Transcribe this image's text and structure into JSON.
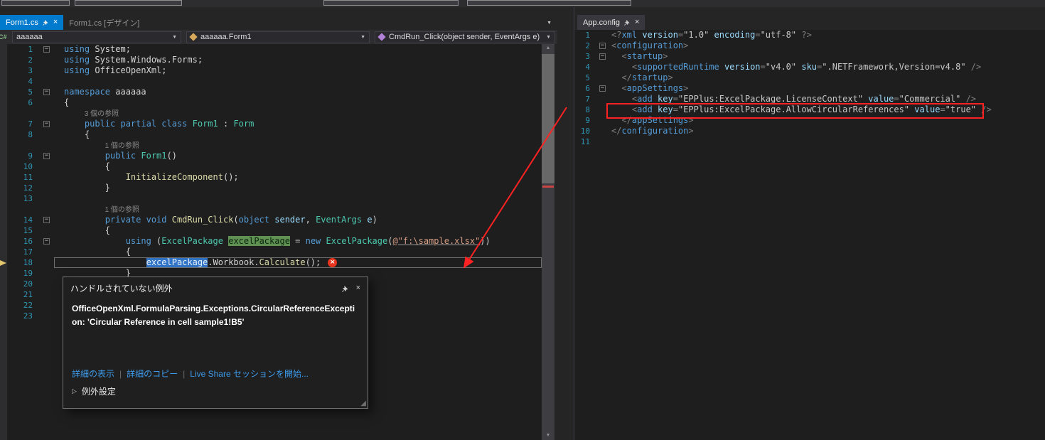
{
  "colors": {
    "accent_blue": "#007ACC",
    "annotation_red": "#FF2222",
    "error_red": "#E8341C",
    "link_blue": "#3E9BE9",
    "keyword": "#569CD6",
    "type": "#4EC9B0",
    "method": "#DCDCAA",
    "string": "#D69D85",
    "line_number": "#2F96B4",
    "reference_highlight_green": "#5E9152",
    "selection_highlight_blue": "#3173C4"
  },
  "icons": {
    "close": "×",
    "chevron_down": "▼",
    "caret_down": "▼",
    "fold_collapse": "−",
    "scroll_up": "▲",
    "scroll_down": "▼",
    "expander": "▷",
    "error": "×",
    "resize_grip": "◢",
    "csharp_project": "C#",
    "link_separator": "|"
  },
  "left_group": {
    "tabs": [
      {
        "label": "Form1.cs",
        "active": true
      },
      {
        "label": "Form1.cs [デザイン]",
        "active": false
      }
    ]
  },
  "navbar": {
    "project": "aaaaaa",
    "type": "aaaaaa.Form1",
    "member": "CmdRun_Click(object sender, EventArgs e)"
  },
  "right_group": {
    "tabs": [
      {
        "label": "App.config",
        "active": true
      }
    ]
  },
  "left_editor": {
    "rows": [
      {
        "n": 1,
        "fold": true,
        "tokens": [
          [
            "using ",
            "kw"
          ],
          [
            "System;",
            "pl"
          ]
        ]
      },
      {
        "n": 2,
        "tokens": [
          [
            "using ",
            "kw"
          ],
          [
            "System.Windows.Forms;",
            "pl"
          ]
        ]
      },
      {
        "n": 3,
        "tokens": [
          [
            "using ",
            "kw"
          ],
          [
            "OfficeOpenXml;",
            "pl"
          ]
        ]
      },
      {
        "n": 4,
        "tokens": []
      },
      {
        "n": 5,
        "fold": true,
        "tokens": [
          [
            "namespace ",
            "kw"
          ],
          [
            "aaaaaa",
            "pl"
          ]
        ]
      },
      {
        "n": 6,
        "tokens": [
          [
            "{",
            "pl"
          ]
        ]
      },
      {
        "codelens": true,
        "indent": 4,
        "text": "3 個の参照"
      },
      {
        "n": 7,
        "fold": true,
        "tokens": [
          [
            "    ",
            "pl"
          ],
          [
            "public partial class ",
            "kw"
          ],
          [
            "Form1",
            "ty"
          ],
          [
            " : ",
            "pl"
          ],
          [
            "Form",
            "ty"
          ]
        ]
      },
      {
        "n": 8,
        "tokens": [
          [
            "    {",
            "pl"
          ]
        ]
      },
      {
        "codelens": true,
        "indent": 8,
        "text": "1 個の参照"
      },
      {
        "n": 9,
        "fold": true,
        "tokens": [
          [
            "        ",
            "pl"
          ],
          [
            "public ",
            "kw"
          ],
          [
            "Form1",
            "ty"
          ],
          [
            "()",
            "pl"
          ]
        ]
      },
      {
        "n": 10,
        "tokens": [
          [
            "        {",
            "pl"
          ]
        ]
      },
      {
        "n": 11,
        "tokens": [
          [
            "            ",
            "pl"
          ],
          [
            "InitializeComponent",
            "me"
          ],
          [
            "();",
            "pl"
          ]
        ]
      },
      {
        "n": 12,
        "tokens": [
          [
            "        }",
            "pl"
          ]
        ]
      },
      {
        "n": 13,
        "tokens": []
      },
      {
        "codelens": true,
        "indent": 8,
        "text": "1 個の参照"
      },
      {
        "n": 14,
        "fold": true,
        "tokens": [
          [
            "        ",
            "pl"
          ],
          [
            "private void ",
            "kw"
          ],
          [
            "CmdRun_Click",
            "me"
          ],
          [
            "(",
            "pl"
          ],
          [
            "object",
            "kw"
          ],
          [
            " ",
            "pl"
          ],
          [
            "sender",
            "pa"
          ],
          [
            ", ",
            "pl"
          ],
          [
            "EventArgs",
            "ty"
          ],
          [
            " ",
            "pl"
          ],
          [
            "e",
            "pa"
          ],
          [
            ")",
            "pl"
          ]
        ]
      },
      {
        "n": 15,
        "tokens": [
          [
            "        {",
            "pl"
          ]
        ]
      },
      {
        "n": 16,
        "fold": true,
        "tokens": [
          [
            "            ",
            "pl"
          ],
          [
            "using",
            "kw"
          ],
          [
            " (",
            "pl"
          ],
          [
            "ExcelPackage",
            "ty"
          ],
          [
            " ",
            "pl"
          ],
          [
            "excelPackage",
            "hlg"
          ],
          [
            " = ",
            "pl"
          ],
          [
            "new",
            "kw"
          ],
          [
            " ",
            "pl"
          ],
          [
            "ExcelPackage",
            "ty"
          ],
          [
            "(",
            "pl"
          ],
          [
            "@\"f:\\sample.xlsx\"",
            "st u"
          ],
          [
            "))",
            "pl"
          ]
        ]
      },
      {
        "n": 17,
        "tokens": [
          [
            "            {",
            "pl"
          ]
        ]
      },
      {
        "n": 18,
        "current": true,
        "err": true,
        "tokens": [
          [
            "                ",
            "pl"
          ],
          [
            "excelPackage",
            "hlb"
          ],
          [
            ".Workbook.",
            "pl"
          ],
          [
            "Calculate",
            "me"
          ],
          [
            "();",
            "pl"
          ]
        ]
      },
      {
        "n": 19,
        "tokens": [
          [
            "            }",
            "pl"
          ]
        ]
      },
      {
        "n": 20,
        "tokens": [
          [
            "        }",
            "pl"
          ]
        ]
      },
      {
        "n": 21,
        "tokens": []
      },
      {
        "n": 22,
        "tokens": [
          [
            "    }",
            "pl"
          ]
        ]
      },
      {
        "n": 23,
        "tokens": [
          [
            "}",
            "pl"
          ]
        ]
      }
    ]
  },
  "right_editor": {
    "rows": [
      {
        "n": 1,
        "tokens": [
          [
            "<?",
            "xd"
          ],
          [
            "xml",
            "xn"
          ],
          [
            " version",
            "xa"
          ],
          [
            "=",
            "xd"
          ],
          [
            "\"1.0\"",
            "xv"
          ],
          [
            " encoding",
            "xa"
          ],
          [
            "=",
            "xd"
          ],
          [
            "\"utf-8\"",
            "xv"
          ],
          [
            " ?>",
            "xd"
          ]
        ]
      },
      {
        "n": 2,
        "fold": true,
        "tokens": [
          [
            "<",
            "xd"
          ],
          [
            "configuration",
            "xn"
          ],
          [
            ">",
            "xd"
          ]
        ]
      },
      {
        "n": 3,
        "fold": true,
        "tokens": [
          [
            "  ",
            "pl"
          ],
          [
            "<",
            "xd"
          ],
          [
            "startup",
            "xn"
          ],
          [
            ">",
            "xd"
          ]
        ]
      },
      {
        "n": 4,
        "tokens": [
          [
            "    ",
            "pl"
          ],
          [
            "<",
            "xd"
          ],
          [
            "supportedRuntime",
            "xn"
          ],
          [
            " version",
            "xa"
          ],
          [
            "=",
            "xd"
          ],
          [
            "\"v4.0\"",
            "xv"
          ],
          [
            " sku",
            "xa"
          ],
          [
            "=",
            "xd"
          ],
          [
            "\".NETFramework,Version=v4.8\"",
            "xv"
          ],
          [
            " />",
            "xd"
          ]
        ]
      },
      {
        "n": 5,
        "tokens": [
          [
            "  ",
            "pl"
          ],
          [
            "</",
            "xd"
          ],
          [
            "startup",
            "xn"
          ],
          [
            ">",
            "xd"
          ]
        ]
      },
      {
        "n": 6,
        "fold": true,
        "tokens": [
          [
            "  ",
            "pl"
          ],
          [
            "<",
            "xd"
          ],
          [
            "appSettings",
            "xn"
          ],
          [
            ">",
            "xd"
          ]
        ]
      },
      {
        "n": 7,
        "tokens": [
          [
            "    ",
            "pl"
          ],
          [
            "<",
            "xd"
          ],
          [
            "add",
            "xn"
          ],
          [
            " key",
            "xa"
          ],
          [
            "=",
            "xd"
          ],
          [
            "\"EPPlus:ExcelPackage.LicenseContext\"",
            "xv"
          ],
          [
            " value",
            "xa"
          ],
          [
            "=",
            "xd"
          ],
          [
            "\"Commercial\"",
            "xv"
          ],
          [
            " />",
            "xd"
          ]
        ]
      },
      {
        "n": 8,
        "tokens": [
          [
            "    ",
            "pl"
          ],
          [
            "<",
            "xd"
          ],
          [
            "add",
            "xn"
          ],
          [
            " key",
            "xa"
          ],
          [
            "=",
            "xd"
          ],
          [
            "\"EPPlus:ExcelPackage.AllowCircularReferences\"",
            "xv"
          ],
          [
            " value",
            "xa"
          ],
          [
            "=",
            "xd"
          ],
          [
            "\"true\"",
            "xv"
          ],
          [
            " />",
            "xd"
          ]
        ]
      },
      {
        "n": 9,
        "tokens": [
          [
            "  ",
            "pl"
          ],
          [
            "</",
            "xd"
          ],
          [
            "appSettings",
            "xn"
          ],
          [
            ">",
            "xd"
          ]
        ]
      },
      {
        "n": 10,
        "tokens": [
          [
            "</",
            "xd"
          ],
          [
            "configuration",
            "xn"
          ],
          [
            ">",
            "xd"
          ]
        ]
      },
      {
        "n": 11,
        "tokens": []
      }
    ]
  },
  "exception_popup": {
    "title": "ハンドルされていない例外",
    "message": "OfficeOpenXml.FormulaParsing.Exceptions.CircularReferenceException: 'Circular Reference in cell sample1!B5'",
    "links": [
      "詳細の表示",
      "詳細のコピー",
      "Live Share セッションを開始..."
    ],
    "settings": "例外設定"
  }
}
